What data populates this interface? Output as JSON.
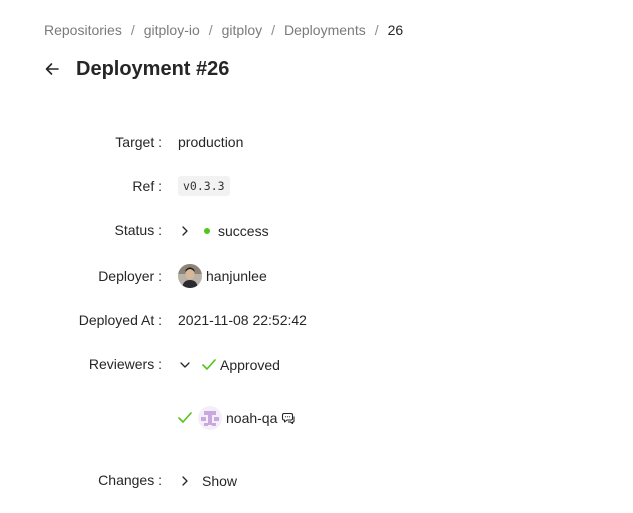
{
  "breadcrumb": {
    "items": [
      "Repositories",
      "gitploy-io",
      "gitploy",
      "Deployments"
    ],
    "current": "26",
    "separator": "/"
  },
  "page": {
    "title": "Deployment #26"
  },
  "fields": {
    "target": {
      "label": "Target",
      "value": "production"
    },
    "ref": {
      "label": "Ref",
      "value": "v0.3.3"
    },
    "status": {
      "label": "Status",
      "value": "success",
      "color": "#52c41a"
    },
    "deployer": {
      "label": "Deployer",
      "value": "hanjunlee"
    },
    "deployed_at": {
      "label": "Deployed At",
      "value": "2021-11-08 22:52:42"
    },
    "reviewers": {
      "label": "Reviewers",
      "summary": "Approved",
      "items": [
        {
          "name": "noah-qa",
          "status": "approved"
        }
      ]
    },
    "changes": {
      "label": "Changes",
      "action": "Show"
    }
  },
  "colors": {
    "success": "#52c41a",
    "muted": "#7a7a7a",
    "text": "#262626"
  }
}
